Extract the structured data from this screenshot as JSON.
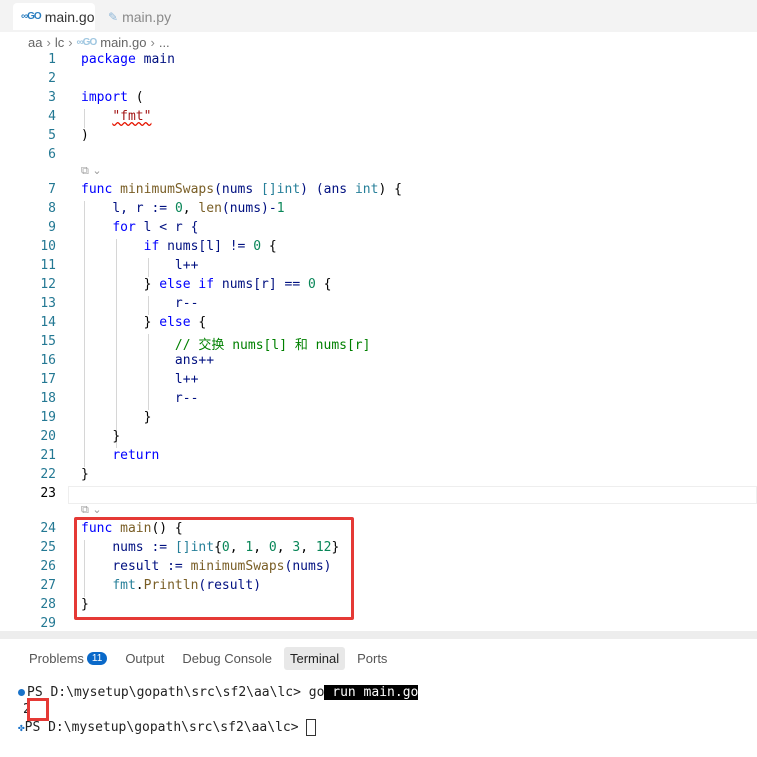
{
  "tabs": [
    {
      "label": "main.go",
      "icon": "go-icon",
      "active": true
    },
    {
      "label": "main.py",
      "icon": "python-icon",
      "active": false
    }
  ],
  "breadcrumb": {
    "parts": [
      "aa",
      "lc",
      "main.go",
      "..."
    ]
  },
  "editor": {
    "lines": [
      {
        "n": "1"
      },
      {
        "n": "2"
      },
      {
        "n": "3"
      },
      {
        "n": "4"
      },
      {
        "n": "5"
      },
      {
        "n": "6"
      },
      {
        "n": "7"
      },
      {
        "n": "8"
      },
      {
        "n": "9"
      },
      {
        "n": "10"
      },
      {
        "n": "11"
      },
      {
        "n": "12"
      },
      {
        "n": "13"
      },
      {
        "n": "14"
      },
      {
        "n": "15"
      },
      {
        "n": "16"
      },
      {
        "n": "17"
      },
      {
        "n": "18"
      },
      {
        "n": "19"
      },
      {
        "n": "20"
      },
      {
        "n": "21"
      },
      {
        "n": "22"
      },
      {
        "n": "23"
      },
      {
        "n": "24"
      },
      {
        "n": "25"
      },
      {
        "n": "26"
      },
      {
        "n": "27"
      },
      {
        "n": "28"
      },
      {
        "n": "29"
      }
    ],
    "code": {
      "l1": [
        "package",
        "main"
      ],
      "l3": [
        "import",
        "("
      ],
      "l4": "\"fmt\"",
      "l5": ")",
      "l7": [
        "func",
        "minimumSwaps",
        "(nums",
        "[]int",
        ") (ans",
        "int",
        ") {"
      ],
      "l8": [
        "l, r := ",
        "0",
        ", ",
        "len",
        "(nums)-",
        "1"
      ],
      "l9": [
        "for",
        " l < r {"
      ],
      "l10": [
        "if",
        " nums[l] != ",
        "0",
        " {"
      ],
      "l11": "l++",
      "l12": [
        "} ",
        "else if",
        " nums[r] == ",
        "0",
        " {"
      ],
      "l13": "r--",
      "l14": [
        "} ",
        "else",
        " {"
      ],
      "l15": "// 交换 nums[l] 和 nums[r]",
      "l16": "ans++",
      "l17": "l++",
      "l18": "r--",
      "l19": "}",
      "l20": "}",
      "l21": "return",
      "l22": "}",
      "l24": [
        "func",
        "main",
        "() {"
      ],
      "l25": [
        "nums := ",
        "[]int",
        "{",
        "0",
        ", ",
        "1",
        ", ",
        "0",
        ", ",
        "3",
        ", ",
        "12",
        "}"
      ],
      "l26": [
        "result := ",
        "minimumSwaps",
        "(nums)"
      ],
      "l27": [
        "fmt",
        ".",
        "Println",
        "(result)"
      ],
      "l28": "}"
    }
  },
  "panel": {
    "tabs": [
      "Problems",
      "Output",
      "Debug Console",
      "Terminal",
      "Ports"
    ],
    "problems_count": "11",
    "active_tab": "Terminal",
    "terminal": {
      "prompt1": "PS D:\\mysetup\\gopath\\src\\sf2\\aa\\lc> ",
      "cmd_go": "go",
      "cmd_rest": " run main.go",
      "output": "2",
      "prompt2": "PS D:\\mysetup\\gopath\\src\\sf2\\aa\\lc> "
    }
  }
}
